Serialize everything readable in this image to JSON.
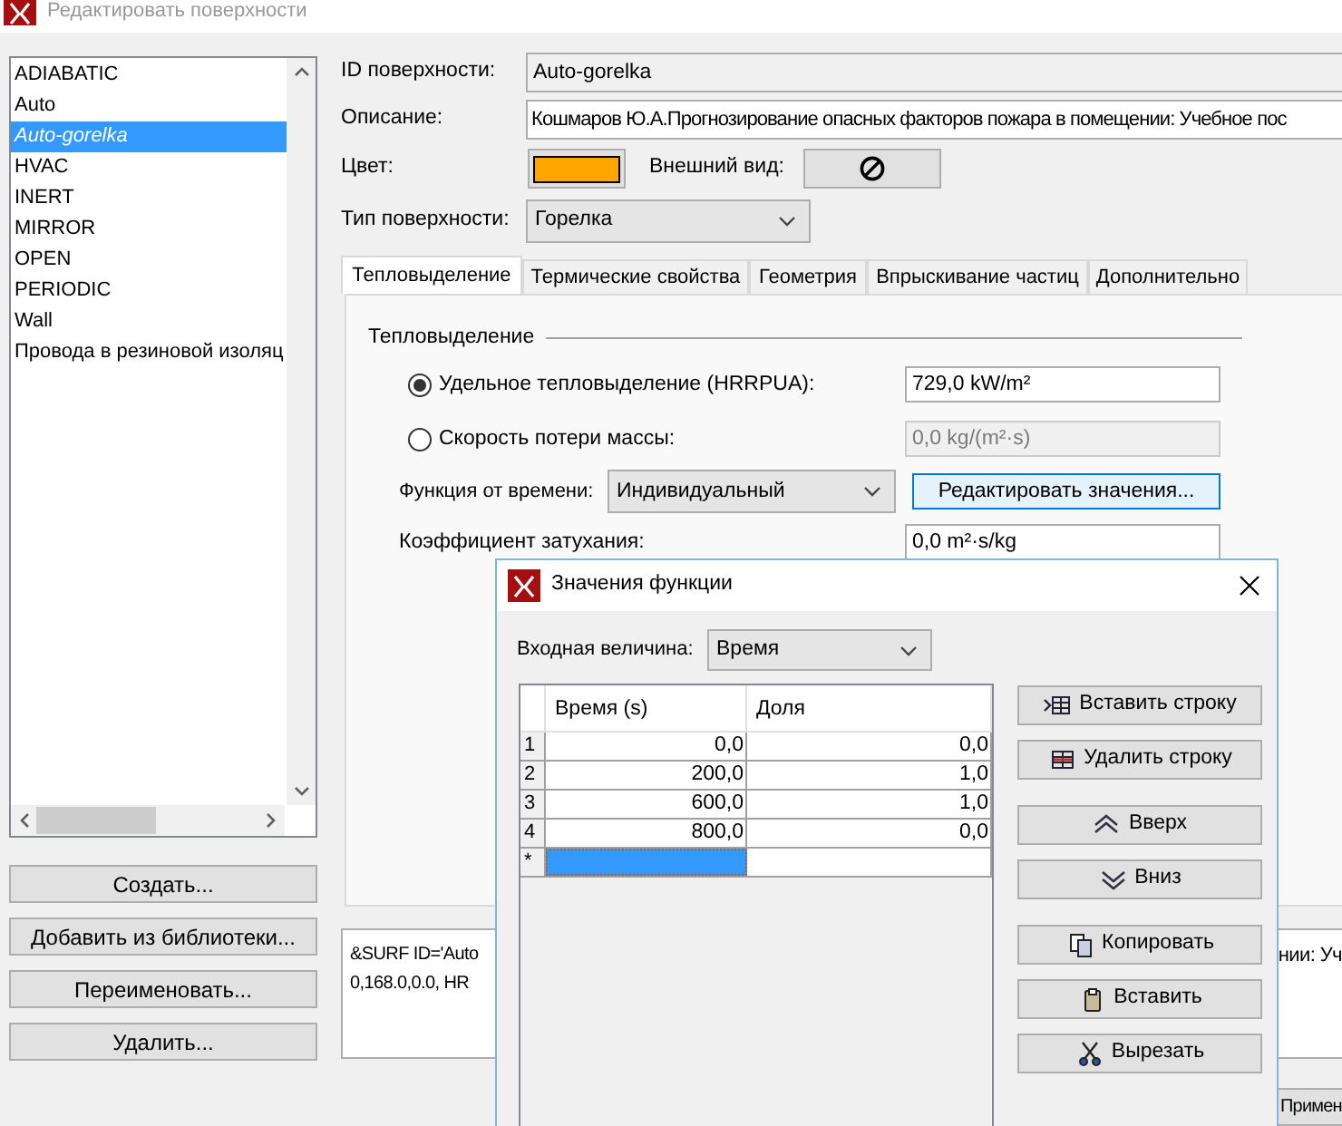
{
  "window": {
    "title": "Редактировать поверхности"
  },
  "surface_list": {
    "items": [
      {
        "label": "ADIABATIC",
        "selected": false,
        "custom": false
      },
      {
        "label": "Auto",
        "selected": false,
        "custom": false
      },
      {
        "label": "Auto-gorelka",
        "selected": true,
        "custom": true
      },
      {
        "label": "HVAC",
        "selected": false,
        "custom": false
      },
      {
        "label": "INERT",
        "selected": false,
        "custom": false
      },
      {
        "label": "MIRROR",
        "selected": false,
        "custom": false
      },
      {
        "label": "OPEN",
        "selected": false,
        "custom": false
      },
      {
        "label": "PERIODIC",
        "selected": false,
        "custom": false
      },
      {
        "label": "Wall",
        "selected": false,
        "custom": false
      },
      {
        "label": "Провода в резиновой изоляц",
        "selected": false,
        "custom": false
      }
    ]
  },
  "list_buttons": [
    "Создать...",
    "Добавить из библиотеки...",
    "Переименовать...",
    "Удалить..."
  ],
  "properties": {
    "id_label": "ID поверхности:",
    "id_value": "Auto-gorelka",
    "description_label": "Описание:",
    "description_value": "Кошмаров Ю.А.Прогнозирование опасных факторов пожара в помещении: Учебное пос",
    "color_label": "Цвет:",
    "color": "#ffa500",
    "appearance_label": "Внешний вид:",
    "type_label": "Тип поверхности:",
    "type_value": "Горелка"
  },
  "tabs": [
    {
      "label": "Тепловыделение",
      "selected": true
    },
    {
      "label": "Термические свойства",
      "selected": false
    },
    {
      "label": "Геометрия",
      "selected": false
    },
    {
      "label": "Впрыскивание частиц",
      "selected": false
    },
    {
      "label": "Дополнительно",
      "selected": false
    }
  ],
  "heat_release": {
    "section_title": "Тепловыделение",
    "options": [
      {
        "label": "Удельное тепловыделение (HRRPUA):",
        "selected": true,
        "value": "729,0 kW/m²",
        "disabled": false
      },
      {
        "label": "Скорость потери массы:",
        "selected": false,
        "value": "0,0 kg/(m²·s)",
        "disabled": true
      }
    ],
    "time_function_label": "Функция от времени:",
    "time_function_value": "Индивидуальный",
    "edit_button": "Редактировать значения...",
    "attenuation_label": "Коэффициент затухания:",
    "attenuation_value": "0,0 m²·s/kg"
  },
  "fds_preview": {
    "line_1": "&SURF ID='Auto",
    "line_2": "0,168.0,0.0, HR",
    "fragment": "нии: Уч"
  },
  "apply_button": "Примен",
  "dialog": {
    "title": "Значения функции",
    "input_label": "Входная величина:",
    "input_value": "Время",
    "columns": [
      "Время (s)",
      "Доля"
    ],
    "rows": [
      {
        "number": "1",
        "cells": [
          "0,0",
          "0,0"
        ]
      },
      {
        "number": "2",
        "cells": [
          "200,0",
          "1,0"
        ]
      },
      {
        "number": "3",
        "cells": [
          "600,0",
          "1,0"
        ]
      },
      {
        "number": "4",
        "cells": [
          "800,0",
          "0,0"
        ]
      }
    ],
    "new_row_marker": "*",
    "buttons": [
      {
        "kind": "insert-row",
        "label": "Вставить строку"
      },
      {
        "kind": "delete-row",
        "label": "Удалить строку"
      },
      {
        "kind": "move-up",
        "label": "Вверх"
      },
      {
        "kind": "move-down",
        "label": "Вниз"
      },
      {
        "kind": "copy",
        "label": "Копировать"
      },
      {
        "kind": "paste",
        "label": "Вставить"
      },
      {
        "kind": "cut",
        "label": "Вырезать"
      }
    ]
  }
}
